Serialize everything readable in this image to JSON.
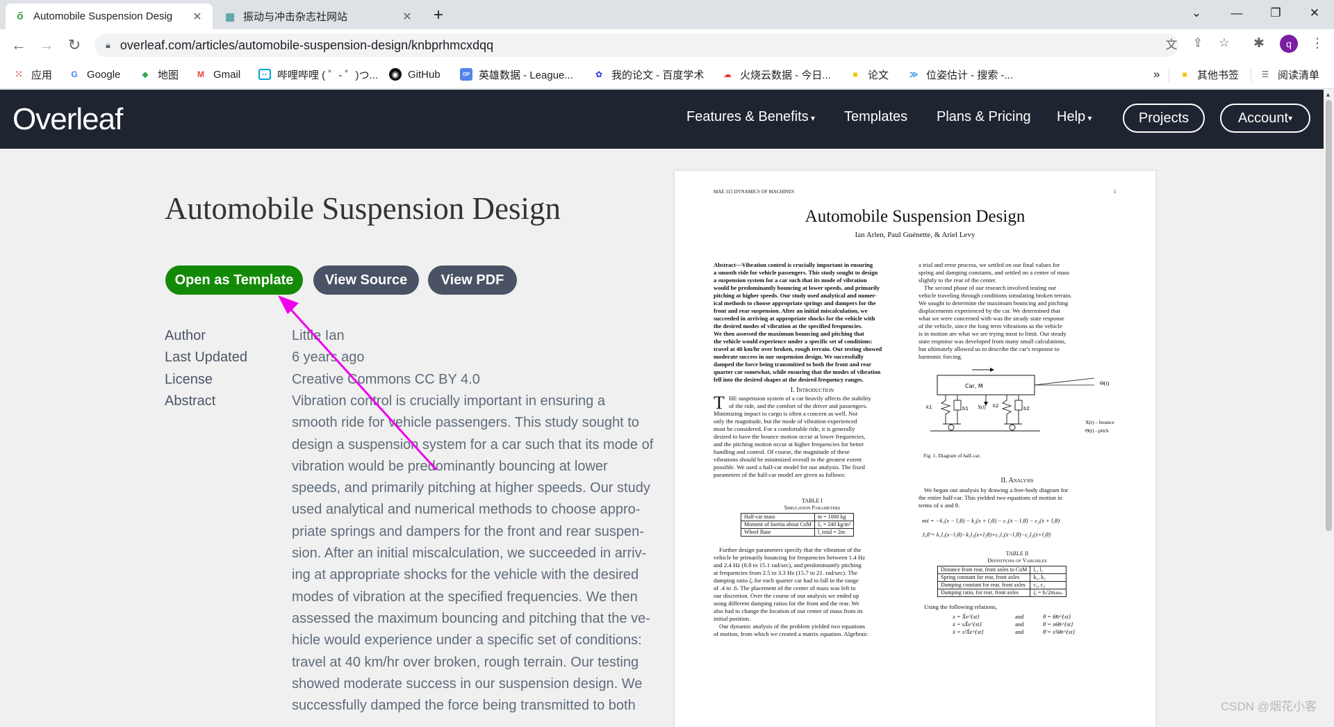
{
  "browser": {
    "tabs": [
      {
        "title": "Automobile Suspension Desig",
        "active": true,
        "favicon": "overleaf-icon"
      },
      {
        "title": "振动与冲击杂志社网站",
        "active": false,
        "favicon": "journal-icon"
      }
    ],
    "new_tab": "+",
    "url": "overleaf.com/articles/automobile-suspension-design/knbprhmcxdqq",
    "profile_initial": "q",
    "bookmarks": [
      {
        "label": "应用",
        "icon": "apps-grid-icon"
      },
      {
        "label": "Google",
        "icon": "google-icon"
      },
      {
        "label": "地图",
        "icon": "maps-icon"
      },
      {
        "label": "Gmail",
        "icon": "gmail-icon"
      },
      {
        "label": "哔哩哔哩 ( ゜- ゜)つ...",
        "icon": "bilibili-icon"
      },
      {
        "label": "GitHub",
        "icon": "github-icon"
      },
      {
        "label": "英雄数据 - League...",
        "icon": "opgg-icon"
      },
      {
        "label": "我的论文 - 百度学术",
        "icon": "baidu-icon"
      },
      {
        "label": "火烧云数据 - 今日...",
        "icon": "cloud-icon"
      },
      {
        "label": "论文",
        "icon": "folder-icon"
      },
      {
        "label": "位姿估计 - 搜索 -...",
        "icon": "bing-icon"
      }
    ],
    "more_bookmarks": "»",
    "other_bookmarks": "其他书签",
    "reading_list": "阅读清单"
  },
  "overleaf_nav": {
    "logo": "Overleaf",
    "links": [
      "Features & Benefits",
      "Templates",
      "Plans & Pricing",
      "Help"
    ],
    "projects": "Projects",
    "account": "Account"
  },
  "page": {
    "title": "Automobile Suspension Design",
    "buttons": {
      "open_template": "Open as Template",
      "view_source": "View Source",
      "view_pdf": "View PDF"
    },
    "meta": {
      "author_label": "Author",
      "author": "Little Ian",
      "updated_label": "Last Updated",
      "updated": "6 years ago",
      "license_label": "License",
      "license": "Creative Commons CC BY 4.0",
      "abstract_label": "Abstract"
    },
    "abstract_lines": [
      "Vibration control is crucially important in ensuring a",
      "smooth ride for vehicle passengers. This study sought to",
      "design a suspension system for a car such that its mode of",
      "vibration would be predominantly bouncing at lower",
      "speeds, and primarily pitching at higher speeds. Our study",
      "used analytical and numerical methods to choose appro-",
      "priate springs and dampers for the front and rear suspen-",
      "sion. After an initial miscalculation, we succeeded in arriv-",
      "ing at appropriate shocks for the vehicle with the desired",
      "modes of vibration at the specified frequencies. We then",
      "assessed the maximum bouncing and pitching that the ve-",
      "hicle would experience under a specific set of conditions:",
      "travel at 40 km/hr over broken, rough terrain. Our testing",
      "showed moderate success in our suspension design. We",
      "successfully damped the force being transmitted to both"
    ]
  },
  "pdf": {
    "header_left": "MAE 315 DYNAMICS OF MACHINES",
    "page_number": "1",
    "title": "Automobile Suspension Design",
    "authors": "Ian Arlen, Paul Guénette, & Ariel Levy",
    "left_abstract": [
      "Abstract—Vibration control is crucially important in ensuring",
      "a smooth ride for vehicle passengers. This study sought to design",
      "a suspension system for a car such that its mode of vibration",
      "would be predominantly bouncing at lower speeds, and primarily",
      "pitching at higher speeds. Our study used analytical and numer-",
      "ical methods to choose appropriate springs and dampers for the",
      "front and rear suspension. After an initial miscalculation, we",
      "succeeded in arriving at appropriate shocks for the vehicle with",
      "the desired modes of vibration at the specified frequencies.",
      "We then assessed the maximum bouncing and pitching that",
      "the vehicle would experience under a specific set of conditions:",
      "travel at 40 km/hr over broken, rough terrain. Our testing showed",
      "moderate success in our suspension design. We successfully",
      "damped the force being transmitted to both the front and rear",
      "quarter car somewhat, while ensuring that the modes of vibration",
      "fell into the desired shapes at the desired frequency ranges."
    ],
    "intro_heading": "I. Introduction",
    "intro_lines": [
      "HE suspension system of a car heavily affects the stability",
      "of the ride, and the comfort of the driver and passengers.",
      "Minimizing impact to cargo is often a concern as well. Not",
      "only the magnitude, but the mode of vibration experienced",
      "must be considered. For a comfortable ride, it is generally",
      "desired to have the bounce motion occur at lower frequencies,",
      "and the pitching motion occur at higher frequencies for better",
      "handling and control. Of course, the magnitude of these",
      "vibrations should be minimized overall to the greatest extent",
      "possible. We used a half-car model for our analysis. The fixed",
      "parameters of the half-car model are given as follows:"
    ],
    "table1_caption": "TABLE I",
    "table1_title": "Simulation Parameters",
    "table1_rows": [
      [
        "Half-car mass",
        "m = 1000 kg"
      ],
      [
        "Moment of Inertia about CoM",
        "J₀ = 240 kg/m²"
      ],
      [
        "Wheel Base",
        "l_total = 2m"
      ]
    ],
    "further_lines": [
      "Further design parameters specify that the vibration of the",
      "vehicle be primarily bouncing for frequencies between 1.4 Hz",
      "and 2.4 Hz (8.8 to 15.1 rad/sec), and predominantly pitching",
      "at frequencies from 2.5 to 3.3 Hz (15.7 to 21. rad/sec). The",
      "damping ratio ζᵢ for each quarter car had to fall in the range",
      "of .4 to .6. The placement of the center of mass was left to",
      "our discretion. Over the course of our analysis we ended up",
      "using different damping ratios for the front and the rear. We",
      "also had to change the location of our center of mass from its",
      "initial position.",
      "Our dynamic analysis of the problem yielded two equations",
      "of motion, from which we created a matrix equation. Algebraic"
    ],
    "right_top_lines": [
      "a trial and error process, we settled on our final values for",
      "spring and damping constants, and settled on a center of mass",
      "slightly to the rear of the center.",
      "The second phase of our research involved testing our",
      "vehicle traveling through conditions simulating broken terrain.",
      "We sought to determine the maximum bouncing and pitching",
      "displacements experienced by the car. We determined that",
      "what we were concerned with was the steady state response",
      "of the vehicle, since the long term vibrations as the vehicle",
      "is in motion are what we are trying most to limit. Our steady",
      "state response was developed from many small calculations,",
      "but ultimately allowed us to describe the car's response to",
      "harmonic forcing."
    ],
    "diagram_labels": {
      "car": "Car, M",
      "theta": "Θ(t)",
      "k1": "k1",
      "b1": "b1",
      "xt": "X(t)",
      "k2": "k2",
      "b2": "b2",
      "legend1": "X(t) – bounce",
      "legend2": "Θ(t) - pitch"
    },
    "fig_caption": "Fig. 1.   Diagram of half-car.",
    "analysis_heading": "II. Analysis",
    "analysis_lines": [
      "We began our analysis by drawing a free-body diagram for",
      "the entire half-car. This yielded two equations of motion in",
      "terms of x and θ."
    ],
    "eq1": "mẍ = −k₁(x − l₁θ) − k₂(x + l₂θ) − c₁(ẋ − l₁θ̇) − c₂(ẋ + l₂θ̇)",
    "eq2": "J₀θ̈ = k₁l₁(x−l₁θ)−k₂l₂(x+l₂θ)+c₁l₁(ẋ−l₁θ̇)−c₂l₂(ẋ+l₂θ̇)",
    "table2_caption": "TABLE II",
    "table2_title": "Definitions of Variables",
    "table2_rows": [
      [
        "Distance from rear, front axles to CoM",
        "l₁, l₂"
      ],
      [
        "Spring constant for rear, front axles",
        "k₁, k₂"
      ],
      [
        "Damping constant for rear, front axles",
        "c₁, c₂"
      ],
      [
        "Damping ratio, for rear, front axles",
        "ζᵢ = bᵢ/2mᵢωₙᵢ"
      ]
    ],
    "relations_intro": "Using the following relations,",
    "relations": [
      [
        "x = X̄e^{st}",
        "and",
        "θ = Θ̄e^{st}"
      ],
      [
        "ẋ = sX̄e^{st}",
        "and",
        "θ̇ = sΘ̄e^{st}"
      ],
      [
        "ẍ = s²X̄e^{st}",
        "and",
        "θ̈ = s²Θ̄e^{st}"
      ]
    ]
  },
  "watermark": "CSDN @烟花小客",
  "colors": {
    "template_button": "#138a07",
    "dark_button": "#495365",
    "nav_bg": "#1e2530",
    "arrow": "#ee00ee"
  }
}
